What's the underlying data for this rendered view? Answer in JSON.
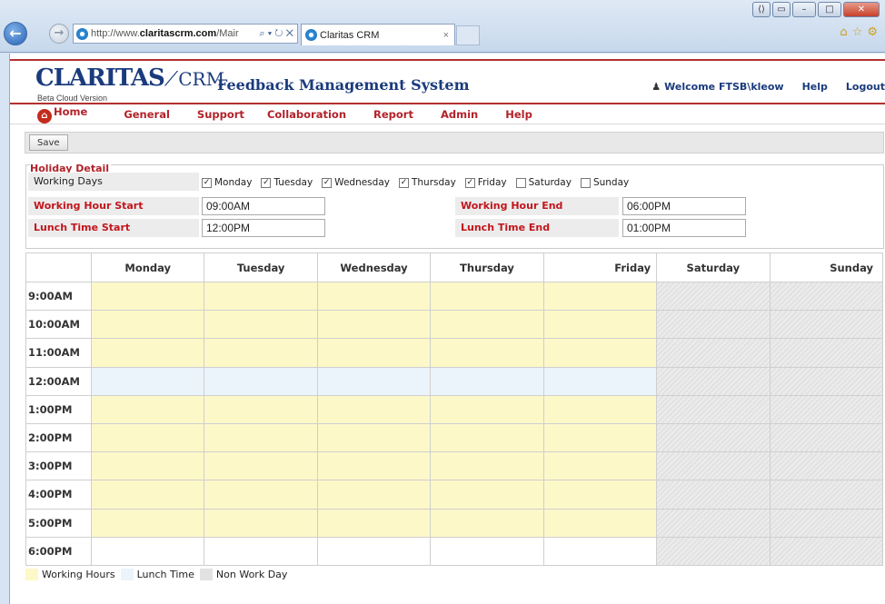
{
  "browser": {
    "url_prefix": "http://www.",
    "url_host": "claritascrm.com",
    "url_rest": "/Mair",
    "tab_title": "Claritas CRM"
  },
  "header": {
    "logo_main": "CLARITAS",
    "logo_crm": "CRM",
    "logo_sub": "Beta Cloud Version",
    "system_title": "Feedback Management System",
    "welcome": "Welcome FTSB\\kleow",
    "help": "Help",
    "logout": "Logout"
  },
  "menu": [
    "Home",
    "General",
    "Support",
    "Collaboration",
    "Report",
    "Admin",
    "Help"
  ],
  "toolbar": {
    "save_label": "Save"
  },
  "holiday": {
    "title": "Holiday Detail",
    "working_days_label": "Working Days",
    "days": [
      {
        "label": "Monday",
        "checked": true
      },
      {
        "label": "Tuesday",
        "checked": true
      },
      {
        "label": "Wednesday",
        "checked": true
      },
      {
        "label": "Thursday",
        "checked": true
      },
      {
        "label": "Friday",
        "checked": true
      },
      {
        "label": "Saturday",
        "checked": false
      },
      {
        "label": "Sunday",
        "checked": false
      }
    ],
    "hour_start_label": "Working Hour Start",
    "hour_start": "09:00AM",
    "hour_end_label": "Working Hour End",
    "hour_end": "06:00PM",
    "lunch_start_label": "Lunch Time Start",
    "lunch_start": "12:00PM",
    "lunch_end_label": "Lunch Time End",
    "lunch_end": "01:00PM"
  },
  "schedule": {
    "columns": [
      "Monday",
      "Tuesday",
      "Wednesday",
      "Thursday",
      "Friday",
      "Saturday",
      "Sunday"
    ],
    "times": [
      "9:00AM",
      "10:00AM",
      "11:00AM",
      "12:00AM",
      "1:00PM",
      "2:00PM",
      "3:00PM",
      "4:00PM",
      "5:00PM",
      "6:00PM"
    ],
    "row_types": [
      "work",
      "work",
      "work",
      "lunch",
      "work",
      "work",
      "work",
      "work",
      "work",
      "blank"
    ],
    "off_columns": [
      5,
      6
    ]
  },
  "legend": {
    "working": "Working Hours",
    "lunch": "Lunch Time",
    "nonwork": "Non Work Day"
  },
  "colors": {
    "accent": "#b2222a",
    "brand": "#1a3b7d",
    "working": "#fdf8c8",
    "lunch": "#ebf4fb",
    "nonwork": "#e2e2e2"
  }
}
